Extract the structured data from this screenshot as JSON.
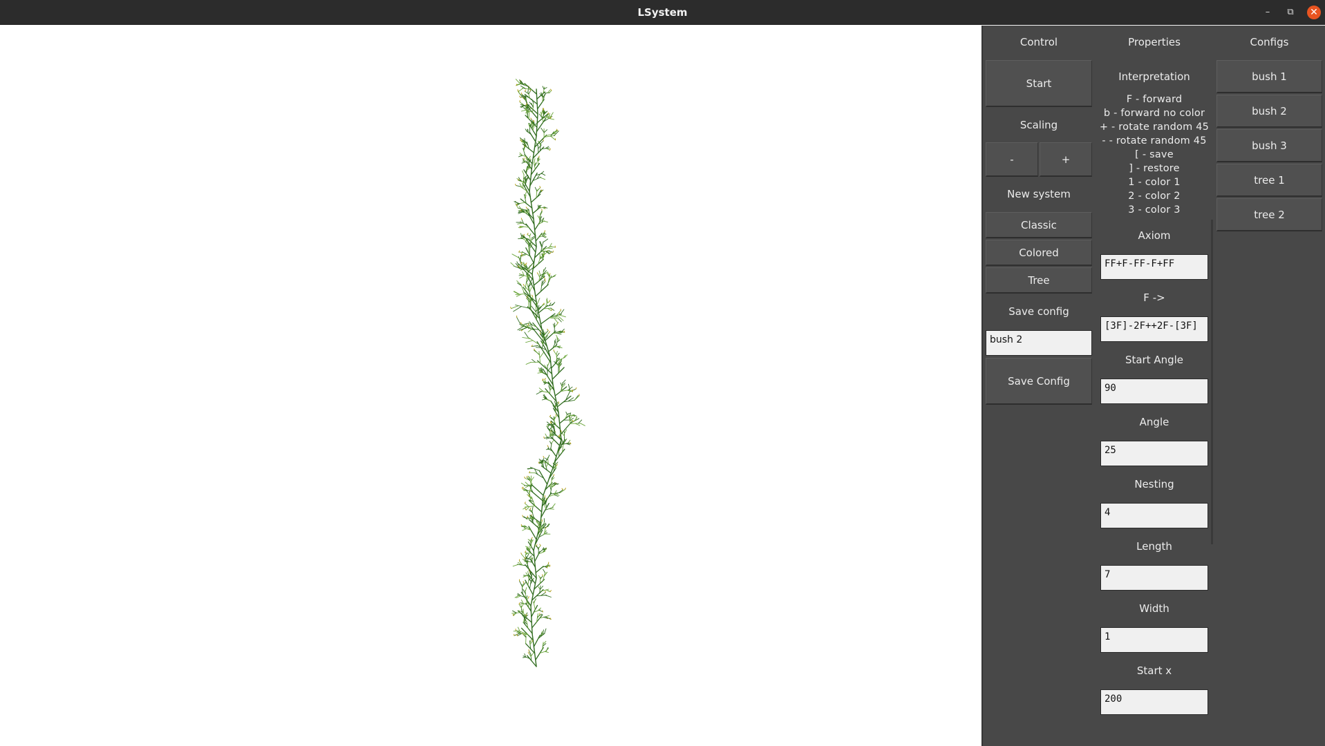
{
  "window": {
    "title": "LSystem",
    "minimize_icon": "–",
    "maximize_icon": "⧉",
    "close_icon": "✕"
  },
  "control": {
    "header": "Control",
    "start_label": "Start",
    "scaling_header": "Scaling",
    "scale_down_label": "-",
    "scale_up_label": "+",
    "new_system_header": "New system",
    "classic_label": "Classic",
    "colored_label": "Colored",
    "tree_label": "Tree",
    "save_config_header": "Save config",
    "save_name_value": "bush 2",
    "save_button_label": "Save Config"
  },
  "properties": {
    "header": "Properties",
    "interpretation_header": "Interpretation",
    "interpretation_lines": [
      "F - forward",
      "b - forward no color",
      "+ - rotate random 45",
      "- - rotate random 45",
      "[ - save",
      "] - restore",
      "1 - color 1",
      "2 - color 2",
      "3 - color 3"
    ],
    "fields": [
      {
        "label": "Axiom",
        "value": "FF+F-FF-F+FF"
      },
      {
        "label": "F ->",
        "value": "[3F]-2F++2F-[3F]"
      },
      {
        "label": "Start Angle",
        "value": "90"
      },
      {
        "label": "Angle",
        "value": "25"
      },
      {
        "label": "Nesting",
        "value": "4"
      },
      {
        "label": "Length",
        "value": "7"
      },
      {
        "label": "Width",
        "value": "1"
      },
      {
        "label": "Start x",
        "value": "200"
      }
    ]
  },
  "configs": {
    "header": "Configs",
    "items": [
      "bush 1",
      "bush 2",
      "bush 3",
      "tree 1",
      "tree 2"
    ]
  },
  "colors": {
    "plant_dark": "#2f6b1e",
    "plant_light": "#6aa53a",
    "plant_yellow": "#b8a01c",
    "panel_bg": "#484848",
    "titlebar_bg": "#2c2c2c",
    "close_button": "#e95420"
  }
}
